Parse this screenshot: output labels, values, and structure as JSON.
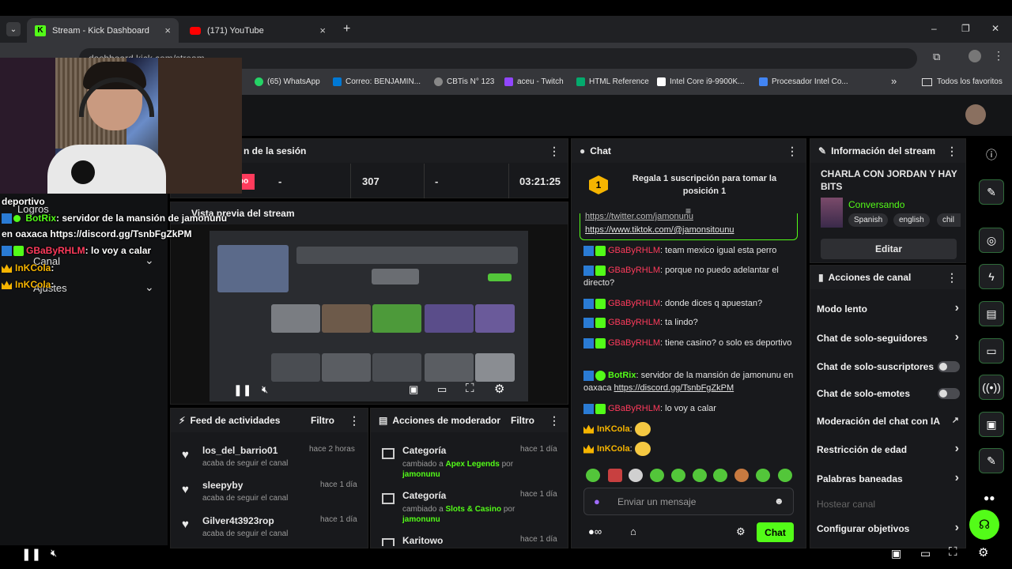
{
  "browser": {
    "tabs": [
      {
        "title": "Stream - Kick Dashboard",
        "close": "×"
      },
      {
        "title": "(171) YouTube",
        "close": "×"
      }
    ],
    "new_tab": "+",
    "url": "dashboard.kick.com/stream",
    "window_controls": [
      "–",
      "❐",
      "✕"
    ],
    "bookmarks": [
      {
        "label": "(65) WhatsApp",
        "color": "#25d366"
      },
      {
        "label": "Correo: BENJAMIN...",
        "color": "#0078d4"
      },
      {
        "label": "CBTis N° 123",
        "color": "#888888"
      },
      {
        "label": "aceu - Twitch",
        "color": "#9146ff"
      },
      {
        "label": "HTML Reference",
        "color": "#04aa6d"
      },
      {
        "label": "Intel Core i9-9900K...",
        "color": "#ffffff"
      },
      {
        "label": "Procesador Intel Co...",
        "color": "#4285f4"
      }
    ],
    "bookmarks_more": "»",
    "all_favorites": "Todos los favoritos"
  },
  "overlay_chat": [
    {
      "user": "",
      "text": "deportivo"
    },
    {
      "user": "BotRix",
      "text": ": servidor de la mansión de jamonunu"
    },
    {
      "user": "",
      "text": "en oaxaca https://discord.gg/TsnbFgZkPM"
    },
    {
      "user": "GBaByRHLM",
      "text": ": lo voy a calar"
    },
    {
      "user": "InKCola",
      "text": ":"
    },
    {
      "user": "InKCola",
      "text": ":"
    }
  ],
  "left_nav": {
    "logros": "Logros",
    "canal": "Canal",
    "ajustes": "Ajustes"
  },
  "session": {
    "title": "n de la sesión",
    "stats": [
      "oo",
      "-",
      "307",
      "-",
      "03:21:25"
    ]
  },
  "preview": {
    "title": "Vista previa del stream"
  },
  "activity_feed": {
    "title": "Feed de actividades",
    "filter": "Filtro",
    "items": [
      {
        "user": "los_del_barrio01",
        "desc": "acaba de seguir el canal",
        "time": "hace 2 horas"
      },
      {
        "user": "sleepyby",
        "desc": "acaba de seguir el canal",
        "time": "hace 1 día"
      },
      {
        "user": "Gilver4t3923rop",
        "desc": "acaba de seguir el canal",
        "time": "hace 1 día"
      }
    ]
  },
  "mod_actions": {
    "title": "Acciones de moderador",
    "filter": "Filtro",
    "items": [
      {
        "title": "Categoría",
        "prefix": "cambiado a ",
        "value": "Apex Legends",
        "by": " por",
        "mod": "jamonunu",
        "time": "hace 1 día"
      },
      {
        "title": "Categoría",
        "prefix": "cambiado a ",
        "value": "Slots & Casino",
        "by": " por",
        "mod": "jamonunu",
        "time": "hace 1 día"
      },
      {
        "title": "Karitowo",
        "prefix": "",
        "value": "",
        "by": "",
        "mod": "",
        "time": "hace 1 día"
      }
    ]
  },
  "chat": {
    "title": "Chat",
    "gift_number": "1",
    "gift_text": "Regala 1 suscripción para tomar la posición 1",
    "pinned_line1": "https://twitter.com/jamonunu",
    "pinned_line2": "https://www.tiktok.com/@jamonsitounu",
    "messages": [
      {
        "user": "GBaByRHLM",
        "text": ": team mexico igual esta perro"
      },
      {
        "user": "GBaByRHLM",
        "text": ": porque no puedo adelantar el directo?"
      },
      {
        "user": "GBaByRHLM",
        "text": ": donde dices q apuestan?"
      },
      {
        "user": "GBaByRHLM",
        "text": ": ta lindo?"
      },
      {
        "user": "GBaByRHLM",
        "text": ": tiene casino? o solo es deportivo"
      },
      {
        "user": "BotRix",
        "text": ": servidor de la mansión de jamonunu en oaxaca ",
        "link": "https://discord.gg/TsnbFgZkPM"
      },
      {
        "user": "GBaByRHLM",
        "text": ": lo voy a calar"
      },
      {
        "user": "InKCola",
        "text": ":"
      },
      {
        "user": "InKCola",
        "text": ":"
      }
    ],
    "input_placeholder": "Enviar un mensaje",
    "send_label": "Chat"
  },
  "stream_info": {
    "title": "Información del stream",
    "stream_title": "CHARLA CON JORDAN Y HAY BITS",
    "category": "Conversando",
    "tags": [
      "Spanish",
      "english",
      "chil"
    ],
    "edit": "Editar"
  },
  "channel_actions": {
    "title": "Acciones de canal",
    "items": [
      {
        "label": "Modo lento",
        "control": "chevron"
      },
      {
        "label": "Chat de solo-seguidores",
        "control": "chevron"
      },
      {
        "label": "Chat de solo-suscriptores",
        "control": "toggle"
      },
      {
        "label": "Chat de solo-emotes",
        "control": "toggle"
      },
      {
        "label": "Moderación del chat con IA",
        "control": "external"
      },
      {
        "label": "Restricción de edad",
        "control": "chevron"
      },
      {
        "label": "Palabras baneadas",
        "control": "chevron"
      },
      {
        "label": "Hostear canal",
        "control": "none"
      },
      {
        "label": "Configurar objetivos",
        "control": "chevron"
      }
    ]
  },
  "colors": {
    "kick_green": "#53fc18",
    "mod_name": "#ff3b5c",
    "sub_name": "#f5b400"
  }
}
